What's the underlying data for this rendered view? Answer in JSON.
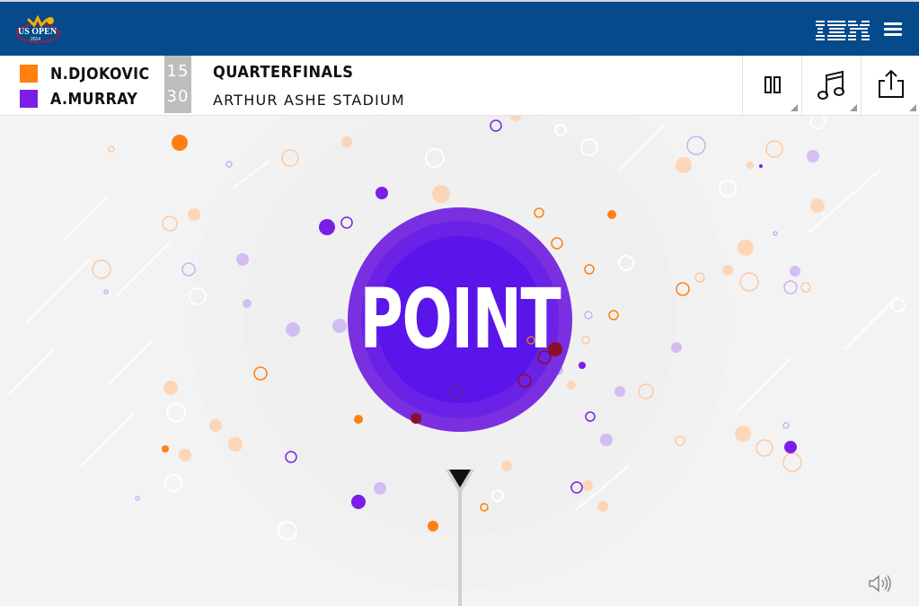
{
  "header": {
    "logo_icon": "us-open-2014-logo",
    "logo_text": "US OPEN",
    "logo_year": "2014",
    "sponsor_icon": "ibm-logo",
    "sponsor_text": "IBM",
    "menu_icon": "hamburger-menu-icon",
    "colors": {
      "bar": "#054a8a"
    }
  },
  "scoreboard": {
    "players": [
      {
        "name": "N.DJOKOVIC",
        "score": "15",
        "color": "#ff7f11"
      },
      {
        "name": "A.MURRAY",
        "score": "30",
        "color": "#7b1fe8"
      }
    ],
    "round": "QUARTERFINALS",
    "venue": "ARTHUR ASHE STADIUM",
    "controls": [
      {
        "icon": "pause-icon"
      },
      {
        "icon": "music-note-icon"
      },
      {
        "icon": "share-icon"
      }
    ]
  },
  "stage": {
    "headline": "POINT",
    "badge_color": "#6a22e6",
    "volume_icon": "speaker-volume-icon"
  }
}
